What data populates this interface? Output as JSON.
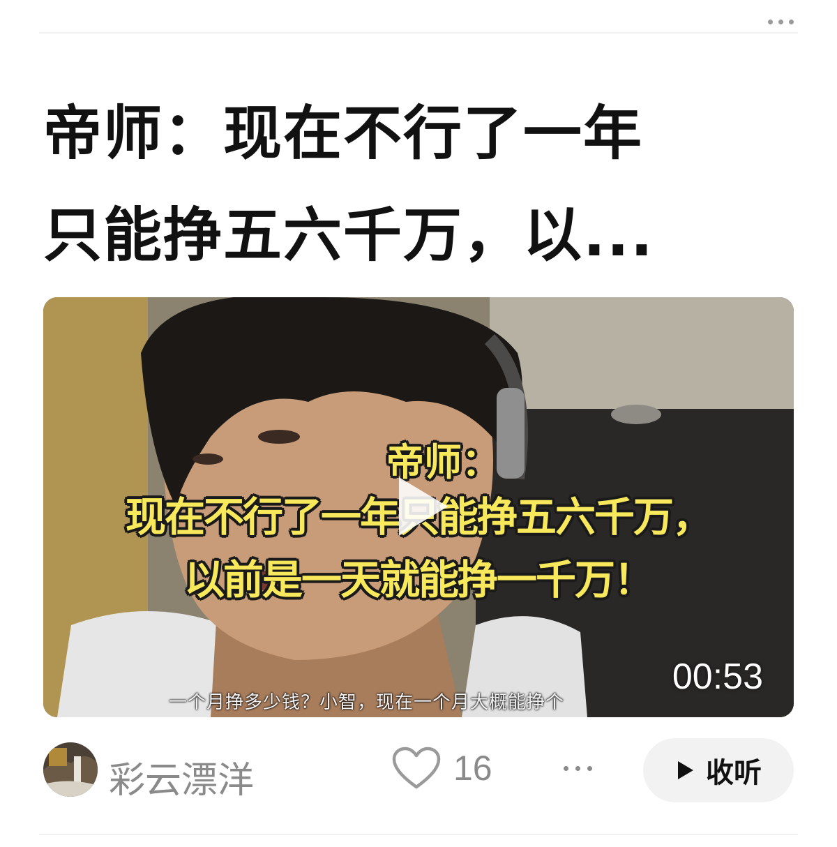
{
  "post": {
    "title_line1": "帝师：现在不行了一年",
    "title_line2": "只能挣五六千万，以...",
    "more_icon": "more-horizontal-icon"
  },
  "video": {
    "overlay_line1": "帝师：",
    "overlay_line2": "现在不行了一年只能挣五六千万，",
    "overlay_line3": "以前是一天就能挣一千万！",
    "subtitle": "一个月挣多少钱？小智，现在一个月大概能挣个",
    "duration": "00:53",
    "play_icon": "play-icon"
  },
  "footer": {
    "author_name": "彩云漂洋",
    "like_count": "16",
    "listen_label": "收听",
    "heart_icon": "heart-icon",
    "play_small_icon": "play-icon"
  },
  "colors": {
    "title": "#111111",
    "meta": "#8a8a8a",
    "overlay_yellow": "#f7e85c",
    "button_bg": "#f2f2f2"
  }
}
